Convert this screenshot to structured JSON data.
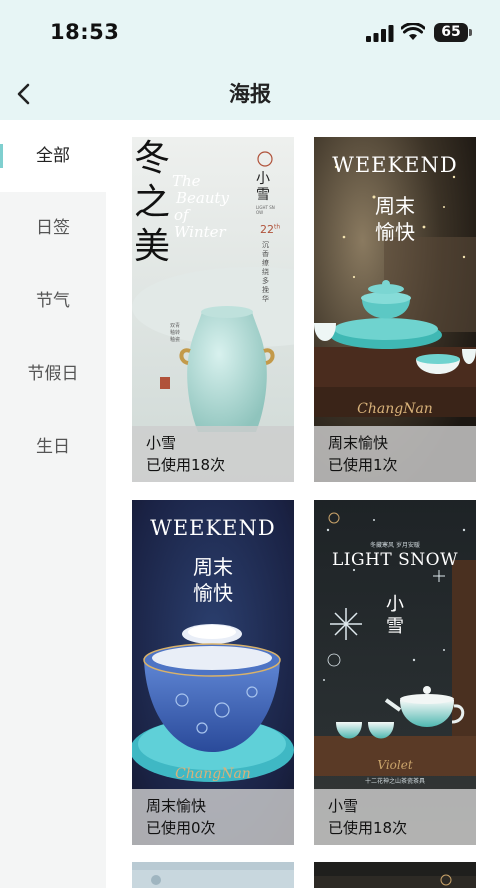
{
  "status_bar": {
    "time": "18:53",
    "battery": "65"
  },
  "nav": {
    "title": "海报"
  },
  "sidebar": {
    "items": [
      {
        "label": "全部"
      },
      {
        "label": "日签"
      },
      {
        "label": "节气"
      },
      {
        "label": "节假日"
      },
      {
        "label": "生日"
      }
    ]
  },
  "posters": [
    {
      "name": "小雪",
      "usage": "已使用18次",
      "art": {
        "big": "冬之美",
        "script_lines": [
          "The",
          "Beauty",
          "of",
          "Winter"
        ],
        "title": "小雪",
        "sub": "LIGHT SNOW",
        "day": "22",
        "day_suffix": "th",
        "poem": "沉香缭绕多挽华",
        "seal": "双青釉转釉瓷"
      }
    },
    {
      "name": "周末愉快",
      "usage": "已使用1次",
      "art": {
        "headline": "WEEKEND",
        "title": "周末愉快",
        "brand": "ChangNan"
      }
    },
    {
      "name": "周末愉快",
      "usage": "已使用0次",
      "art": {
        "headline": "WEEKEND",
        "title": "周末愉快",
        "brand": "ChangNan"
      }
    },
    {
      "name": "小雪",
      "usage": "已使用18次",
      "art": {
        "kicker": "冬藏寒风 岁月安暖",
        "headline": "LIGHT SNOW",
        "title": "小雪",
        "brand": "Violet",
        "footer": "十二花神之山茶瓷茶具"
      }
    }
  ]
}
